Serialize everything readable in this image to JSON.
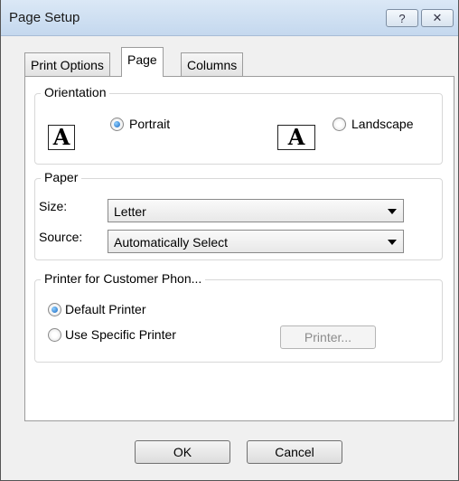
{
  "window": {
    "title": "Page Setup",
    "help_glyph": "?",
    "close_glyph": "✕"
  },
  "tabs": [
    {
      "label": "Print Options",
      "selected": false
    },
    {
      "label": "Page",
      "selected": true
    },
    {
      "label": "Columns",
      "selected": false
    }
  ],
  "orientation": {
    "legend": "Orientation",
    "portrait_label": "Portrait",
    "landscape_label": "Landscape",
    "icon_glyph": "A",
    "selected": "Portrait"
  },
  "paper": {
    "legend": "Paper",
    "size_label": "Size:",
    "size_value": "Letter",
    "source_label": "Source:",
    "source_value": "Automatically Select"
  },
  "printer": {
    "legend": "Printer for Customer Phon...",
    "default_label": "Default Printer",
    "specific_label": "Use Specific Printer",
    "printer_button": "Printer...",
    "selected": "Default Printer"
  },
  "footer": {
    "ok_label": "OK",
    "cancel_label": "Cancel"
  }
}
